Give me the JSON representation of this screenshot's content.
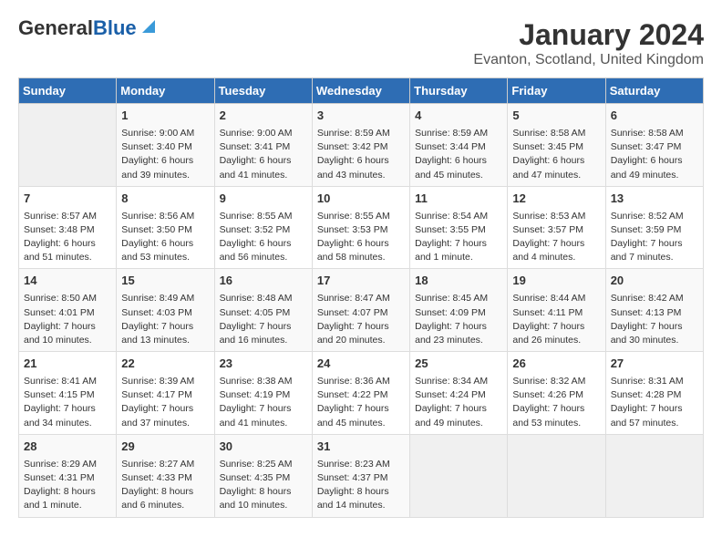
{
  "header": {
    "logo_general": "General",
    "logo_blue": "Blue",
    "title": "January 2024",
    "subtitle": "Evanton, Scotland, United Kingdom"
  },
  "days_of_week": [
    "Sunday",
    "Monday",
    "Tuesday",
    "Wednesday",
    "Thursday",
    "Friday",
    "Saturday"
  ],
  "weeks": [
    [
      {
        "day": "",
        "info": ""
      },
      {
        "day": "1",
        "info": "Sunrise: 9:00 AM\nSunset: 3:40 PM\nDaylight: 6 hours\nand 39 minutes."
      },
      {
        "day": "2",
        "info": "Sunrise: 9:00 AM\nSunset: 3:41 PM\nDaylight: 6 hours\nand 41 minutes."
      },
      {
        "day": "3",
        "info": "Sunrise: 8:59 AM\nSunset: 3:42 PM\nDaylight: 6 hours\nand 43 minutes."
      },
      {
        "day": "4",
        "info": "Sunrise: 8:59 AM\nSunset: 3:44 PM\nDaylight: 6 hours\nand 45 minutes."
      },
      {
        "day": "5",
        "info": "Sunrise: 8:58 AM\nSunset: 3:45 PM\nDaylight: 6 hours\nand 47 minutes."
      },
      {
        "day": "6",
        "info": "Sunrise: 8:58 AM\nSunset: 3:47 PM\nDaylight: 6 hours\nand 49 minutes."
      }
    ],
    [
      {
        "day": "7",
        "info": "Sunrise: 8:57 AM\nSunset: 3:48 PM\nDaylight: 6 hours\nand 51 minutes."
      },
      {
        "day": "8",
        "info": "Sunrise: 8:56 AM\nSunset: 3:50 PM\nDaylight: 6 hours\nand 53 minutes."
      },
      {
        "day": "9",
        "info": "Sunrise: 8:55 AM\nSunset: 3:52 PM\nDaylight: 6 hours\nand 56 minutes."
      },
      {
        "day": "10",
        "info": "Sunrise: 8:55 AM\nSunset: 3:53 PM\nDaylight: 6 hours\nand 58 minutes."
      },
      {
        "day": "11",
        "info": "Sunrise: 8:54 AM\nSunset: 3:55 PM\nDaylight: 7 hours\nand 1 minute."
      },
      {
        "day": "12",
        "info": "Sunrise: 8:53 AM\nSunset: 3:57 PM\nDaylight: 7 hours\nand 4 minutes."
      },
      {
        "day": "13",
        "info": "Sunrise: 8:52 AM\nSunset: 3:59 PM\nDaylight: 7 hours\nand 7 minutes."
      }
    ],
    [
      {
        "day": "14",
        "info": "Sunrise: 8:50 AM\nSunset: 4:01 PM\nDaylight: 7 hours\nand 10 minutes."
      },
      {
        "day": "15",
        "info": "Sunrise: 8:49 AM\nSunset: 4:03 PM\nDaylight: 7 hours\nand 13 minutes."
      },
      {
        "day": "16",
        "info": "Sunrise: 8:48 AM\nSunset: 4:05 PM\nDaylight: 7 hours\nand 16 minutes."
      },
      {
        "day": "17",
        "info": "Sunrise: 8:47 AM\nSunset: 4:07 PM\nDaylight: 7 hours\nand 20 minutes."
      },
      {
        "day": "18",
        "info": "Sunrise: 8:45 AM\nSunset: 4:09 PM\nDaylight: 7 hours\nand 23 minutes."
      },
      {
        "day": "19",
        "info": "Sunrise: 8:44 AM\nSunset: 4:11 PM\nDaylight: 7 hours\nand 26 minutes."
      },
      {
        "day": "20",
        "info": "Sunrise: 8:42 AM\nSunset: 4:13 PM\nDaylight: 7 hours\nand 30 minutes."
      }
    ],
    [
      {
        "day": "21",
        "info": "Sunrise: 8:41 AM\nSunset: 4:15 PM\nDaylight: 7 hours\nand 34 minutes."
      },
      {
        "day": "22",
        "info": "Sunrise: 8:39 AM\nSunset: 4:17 PM\nDaylight: 7 hours\nand 37 minutes."
      },
      {
        "day": "23",
        "info": "Sunrise: 8:38 AM\nSunset: 4:19 PM\nDaylight: 7 hours\nand 41 minutes."
      },
      {
        "day": "24",
        "info": "Sunrise: 8:36 AM\nSunset: 4:22 PM\nDaylight: 7 hours\nand 45 minutes."
      },
      {
        "day": "25",
        "info": "Sunrise: 8:34 AM\nSunset: 4:24 PM\nDaylight: 7 hours\nand 49 minutes."
      },
      {
        "day": "26",
        "info": "Sunrise: 8:32 AM\nSunset: 4:26 PM\nDaylight: 7 hours\nand 53 minutes."
      },
      {
        "day": "27",
        "info": "Sunrise: 8:31 AM\nSunset: 4:28 PM\nDaylight: 7 hours\nand 57 minutes."
      }
    ],
    [
      {
        "day": "28",
        "info": "Sunrise: 8:29 AM\nSunset: 4:31 PM\nDaylight: 8 hours\nand 1 minute."
      },
      {
        "day": "29",
        "info": "Sunrise: 8:27 AM\nSunset: 4:33 PM\nDaylight: 8 hours\nand 6 minutes."
      },
      {
        "day": "30",
        "info": "Sunrise: 8:25 AM\nSunset: 4:35 PM\nDaylight: 8 hours\nand 10 minutes."
      },
      {
        "day": "31",
        "info": "Sunrise: 8:23 AM\nSunset: 4:37 PM\nDaylight: 8 hours\nand 14 minutes."
      },
      {
        "day": "",
        "info": ""
      },
      {
        "day": "",
        "info": ""
      },
      {
        "day": "",
        "info": ""
      }
    ]
  ]
}
